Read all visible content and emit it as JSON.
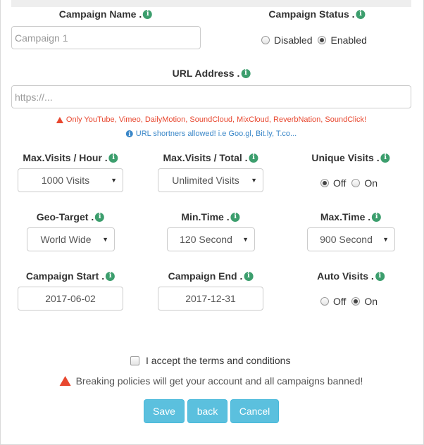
{
  "campaign_name": {
    "label": "Campaign Name .",
    "placeholder": "Campaign 1"
  },
  "campaign_status": {
    "label": "Campaign Status .",
    "options": [
      "Disabled",
      "Enabled"
    ],
    "selected": "Enabled"
  },
  "url_address": {
    "label": "URL Address .",
    "placeholder": "https://..."
  },
  "notices": {
    "warning": "Only YouTube, Vimeo, DailyMotion, SoundCloud, MixCloud, ReverbNation, SoundClick!",
    "info": "URL shortners allowed! i.e Goo.gl, Bit.ly, T.co..."
  },
  "max_visits_hour": {
    "label": "Max.Visits / Hour .",
    "value": "1000 Visits"
  },
  "max_visits_total": {
    "label": "Max.Visits / Total .",
    "value": "Unlimited Visits"
  },
  "unique_visits": {
    "label": "Unique Visits .",
    "options": [
      "Off",
      "On"
    ],
    "selected": "Off"
  },
  "geo_target": {
    "label": "Geo-Target .",
    "value": "World Wide"
  },
  "min_time": {
    "label": "Min.Time .",
    "value": "120 Second"
  },
  "max_time": {
    "label": "Max.Time .",
    "value": "900 Second"
  },
  "campaign_start": {
    "label": "Campaign Start .",
    "value": "2017-06-02"
  },
  "campaign_end": {
    "label": "Campaign End .",
    "value": "2017-12-31"
  },
  "auto_visits": {
    "label": "Auto Visits .",
    "options": [
      "Off",
      "On"
    ],
    "selected": "On"
  },
  "terms": {
    "label": "I accept the terms and conditions"
  },
  "policy_warning": "Breaking policies will get your account and all campaigns banned!",
  "buttons": {
    "save": "Save",
    "back": "back",
    "cancel": "Cancel"
  },
  "colors": {
    "info_icon": "#3c9e6d",
    "warning": "#e8472f",
    "info_text": "#3a87c8",
    "button": "#5bc0de"
  },
  "icons": {
    "field_info": "info-circle-icon",
    "warning": "warning-triangle-icon",
    "notice_info": "info-circle-icon"
  }
}
